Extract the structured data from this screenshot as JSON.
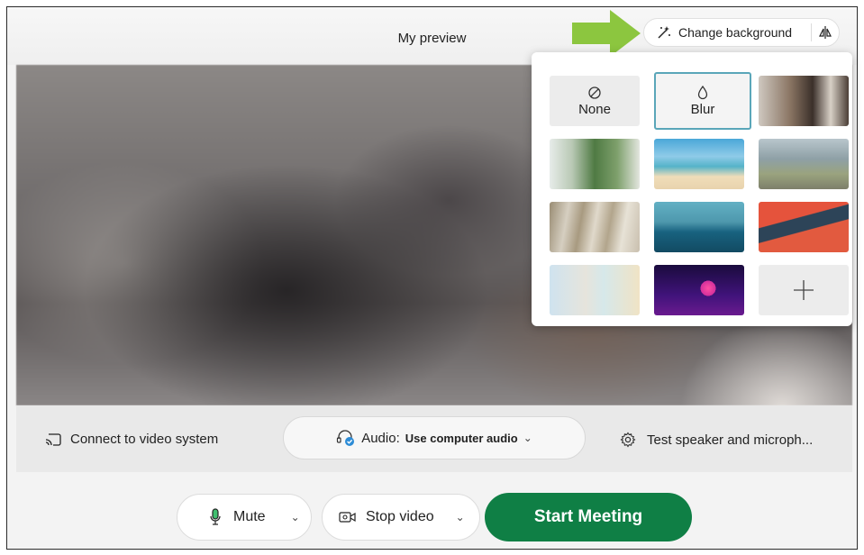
{
  "preview": {
    "title": "My preview"
  },
  "header": {
    "change_background_label": "Change background",
    "change_background_icon": "magic-wand-icon",
    "mirror_icon": "mirror-icon"
  },
  "background_panel": {
    "none_label": "None",
    "blur_label": "Blur",
    "selected": "Blur",
    "items": [
      {
        "name": "none",
        "label": "None"
      },
      {
        "name": "blur",
        "label": "Blur"
      },
      {
        "name": "office"
      },
      {
        "name": "living-room"
      },
      {
        "name": "beach"
      },
      {
        "name": "blurred-landscape"
      },
      {
        "name": "shadow-wall"
      },
      {
        "name": "mountains"
      },
      {
        "name": "orange-abstract"
      },
      {
        "name": "pastel-shapes"
      },
      {
        "name": "space-planet"
      },
      {
        "name": "add-background"
      }
    ]
  },
  "bottom_bar": {
    "connect_label": "Connect to video system",
    "audio_prefix": "Audio:",
    "audio_value": "Use computer audio",
    "test_label": "Test speaker and microph..."
  },
  "controls": {
    "mute_label": "Mute",
    "stop_video_label": "Stop video",
    "start_meeting_label": "Start Meeting"
  },
  "colors": {
    "start_button": "#0f7f45",
    "selected_outline": "#5aa6b9",
    "arrow": "#8cc63f"
  }
}
